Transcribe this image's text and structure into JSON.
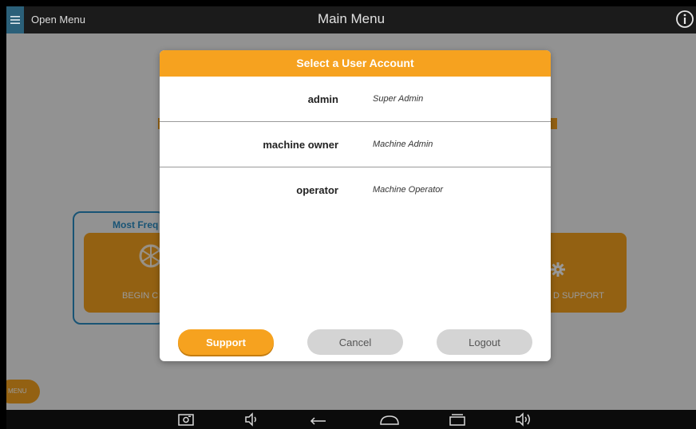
{
  "topbar": {
    "open_menu_label": "Open Menu",
    "title": "Main Menu",
    "icons": [
      "hamburger-icon",
      "info-icon"
    ]
  },
  "background": {
    "freq_label": "Most Freq",
    "tile_left_label": "BEGIN C",
    "tile_right_label": "D SUPPORT",
    "menu_pill_label": "MENU"
  },
  "dialog": {
    "title": "Select a User Account",
    "accounts": [
      {
        "name": "admin",
        "role": "Super Admin"
      },
      {
        "name": "machine owner",
        "role": "Machine Admin"
      },
      {
        "name": "operator",
        "role": "Machine Operator"
      }
    ],
    "buttons": {
      "support": "Support",
      "cancel": "Cancel",
      "logout": "Logout"
    }
  },
  "navbar": {
    "icons": [
      "screenshot-icon",
      "volume-down-icon",
      "back-icon",
      "home-icon",
      "recents-icon",
      "volume-up-icon"
    ]
  },
  "colors": {
    "accent": "#f6a21f",
    "topbar": "#1b1b1b",
    "hamburger_bg": "#2b6079",
    "frame_border": "#2b8cc4",
    "button_disabled": "#d4d4d4"
  }
}
